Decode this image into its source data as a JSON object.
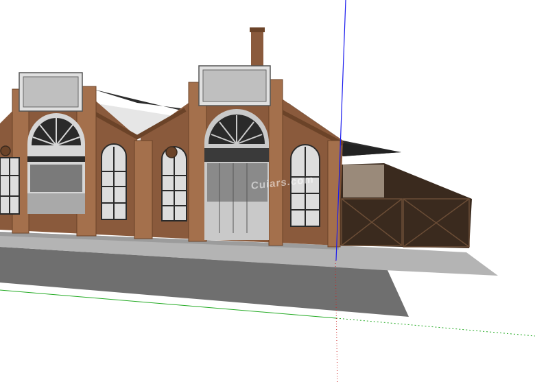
{
  "app": {
    "viewport_name": "3d-model-viewport"
  },
  "model": {
    "subject": "brick-industrial-hall-with-sawtooth-roof",
    "colors": {
      "background": "#ffffff",
      "brick": "#8a5a3c",
      "brick_dark": "#6b4328",
      "brick_light": "#a4704c",
      "roof": "#2b2b2b",
      "roof_light": "#e6e6e6",
      "sign": "#cfcfcf",
      "window": "#2a2a2a",
      "pavement": "#b4b4b4",
      "shadow": "#6f6f6f",
      "fence": "#4a3526",
      "axis_green": "#22aa22",
      "axis_blue": "#1a1aee",
      "axis_red": "#cc2222"
    }
  },
  "watermark": {
    "text": "Cuiars.com"
  }
}
